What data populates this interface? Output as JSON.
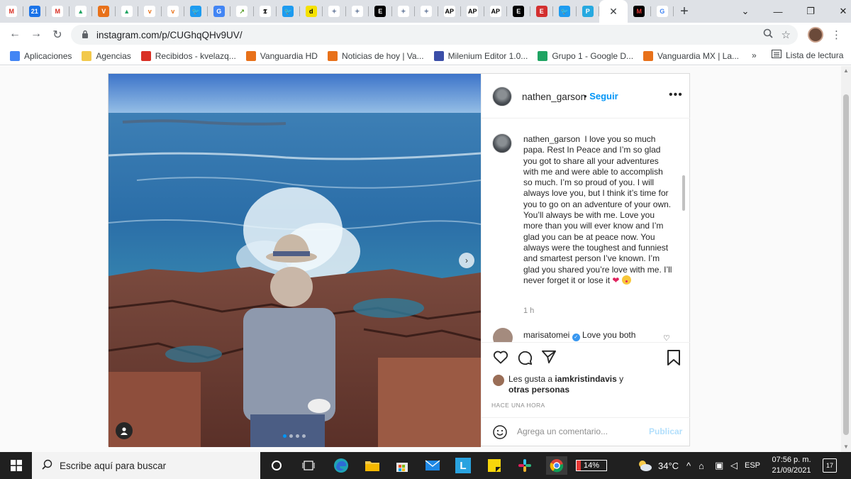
{
  "browser": {
    "tabs": [
      {
        "name": "gmail-icon",
        "glyph": "M",
        "bg": "#ffffff",
        "fg": "#d93025"
      },
      {
        "name": "calendar-icon",
        "glyph": "21",
        "bg": "#1a73e8",
        "fg": "#ffffff"
      },
      {
        "name": "gmail-icon",
        "glyph": "M",
        "bg": "#ffffff",
        "fg": "#d93025"
      },
      {
        "name": "drive-icon",
        "glyph": "▲",
        "bg": "#ffffff",
        "fg": "#1fa463"
      },
      {
        "name": "vanguardia-icon",
        "glyph": "V",
        "bg": "#e8711a",
        "fg": "#ffffff"
      },
      {
        "name": "drive-icon",
        "glyph": "▲",
        "bg": "#ffffff",
        "fg": "#1fa463"
      },
      {
        "name": "vanguardia-icon",
        "glyph": "v",
        "bg": "#ffffff",
        "fg": "#e8711a"
      },
      {
        "name": "vanguardia-icon",
        "glyph": "v",
        "bg": "#ffffff",
        "fg": "#e8711a"
      },
      {
        "name": "twitter-icon",
        "glyph": "🐦",
        "bg": "#1d9bf0",
        "fg": "#ffffff"
      },
      {
        "name": "translate-icon",
        "glyph": "G",
        "bg": "#4285f4",
        "fg": "#ffffff"
      },
      {
        "name": "analytics-icon",
        "glyph": "↗",
        "bg": "#ffffff",
        "fg": "#5aa02c"
      },
      {
        "name": "nyt-icon",
        "glyph": "𝕿",
        "bg": "#ffffff",
        "fg": "#000000"
      },
      {
        "name": "twitter-icon",
        "glyph": "🐦",
        "bg": "#1d9bf0",
        "fg": "#ffffff"
      },
      {
        "name": "d-icon",
        "glyph": "d",
        "bg": "#f5e100",
        "fg": "#000000"
      },
      {
        "name": "eye-icon",
        "glyph": "✦",
        "bg": "#ffffff",
        "fg": "#7a8ba8"
      },
      {
        "name": "eye-icon",
        "glyph": "✦",
        "bg": "#ffffff",
        "fg": "#7a8ba8"
      },
      {
        "name": "excelsior-icon",
        "glyph": "E",
        "bg": "#000000",
        "fg": "#ffffff"
      },
      {
        "name": "eye-icon",
        "glyph": "✦",
        "bg": "#ffffff",
        "fg": "#7a8ba8"
      },
      {
        "name": "eye-icon",
        "glyph": "✦",
        "bg": "#ffffff",
        "fg": "#7a8ba8"
      },
      {
        "name": "ap-icon",
        "glyph": "AP",
        "bg": "#ffffff",
        "fg": "#000000"
      },
      {
        "name": "ap-icon",
        "glyph": "AP",
        "bg": "#ffffff",
        "fg": "#000000"
      },
      {
        "name": "ap-icon",
        "glyph": "AP",
        "bg": "#ffffff",
        "fg": "#000000"
      },
      {
        "name": "excelsior-icon",
        "glyph": "E",
        "bg": "#000000",
        "fg": "#ffffff"
      },
      {
        "name": "elfinanciero-icon",
        "glyph": "E",
        "bg": "#d32f2f",
        "fg": "#ffffff"
      },
      {
        "name": "twitter-icon",
        "glyph": "🐦",
        "bg": "#1d9bf0",
        "fg": "#ffffff"
      },
      {
        "name": "p-icon",
        "glyph": "P",
        "bg": "#26a9e0",
        "fg": "#ffffff"
      }
    ],
    "active_tab": {
      "name": "instagram-tab",
      "close": "✕"
    },
    "after_tabs": [
      {
        "name": "m-icon",
        "glyph": "M",
        "bg": "#000000",
        "fg": "#e53935"
      },
      {
        "name": "google-icon",
        "glyph": "G",
        "bg": "#ffffff",
        "fg": "#4285f4"
      }
    ],
    "new_tab": "+",
    "window_controls": {
      "menu": "⌄",
      "minimize": "—",
      "restore": "❐",
      "close": "✕"
    },
    "url": "instagram.com/p/CUGhqQHv9UV/",
    "bookmarks": [
      {
        "label": "Aplicaciones",
        "icon": "apps-icon",
        "color": "#4285f4"
      },
      {
        "label": "Agencias",
        "icon": "folder-icon",
        "color": "#f2c94c"
      },
      {
        "label": "Recibidos - kvelazq...",
        "icon": "gmail-icon",
        "color": "#d93025"
      },
      {
        "label": "Vanguardia HD",
        "icon": "vanguardia-icon",
        "color": "#e8711a"
      },
      {
        "label": "Noticias de hoy | Va...",
        "icon": "vanguardia-icon",
        "color": "#e8711a"
      },
      {
        "label": "Milenium Editor 1.0...",
        "icon": "milenium-icon",
        "color": "#3b4ea8"
      },
      {
        "label": "Grupo 1 - Google D...",
        "icon": "drive-icon",
        "color": "#1fa463"
      },
      {
        "label": "Vanguardia MX | La...",
        "icon": "vanguardia-icon",
        "color": "#e8711a"
      }
    ],
    "bookmarks_more": "»",
    "reading_list": "Lista de lectura"
  },
  "post": {
    "username": "nathen_garson",
    "follow_separator": "•",
    "follow_label": "Seguir",
    "caption": "I love you so much papa. Rest In Peace and I’m so glad you got to share all your adventures with me and were able to accomplish so much. I’m so proud of you. I will always love you, but I think it’s time for you to go on an adventure of your own. You’ll always be with me. Love you more than you will ever know and I’m glad you can be at peace now. You always were the toughest and funniest and smartest person I’ve known. I’m glad you shared you’re love with me. I’ll never forget it or lose it",
    "caption_time": "1 h",
    "comment_user": "marisatomei",
    "comment_text": "Love you both",
    "likes_prefix": "Les gusta a",
    "likes_user": "iamkristindavis",
    "likes_conj": "y",
    "likes_others": "otras personas",
    "posted_ago": "HACE UNA HORA",
    "add_comment_placeholder": "Agrega un comentario...",
    "publish_label": "Publicar",
    "carousel_total": 4,
    "carousel_index": 1
  },
  "taskbar": {
    "search_placeholder": "Escribe aquí para buscar",
    "battery": "14%",
    "temperature": "34°C",
    "language": "ESP",
    "time": "07:56 p. m.",
    "date": "21/09/2021",
    "notifications": "17"
  },
  "colors": {
    "instagram_blue": "#0095f6",
    "like_red": "#ed4956",
    "taskbar": "#202020"
  }
}
